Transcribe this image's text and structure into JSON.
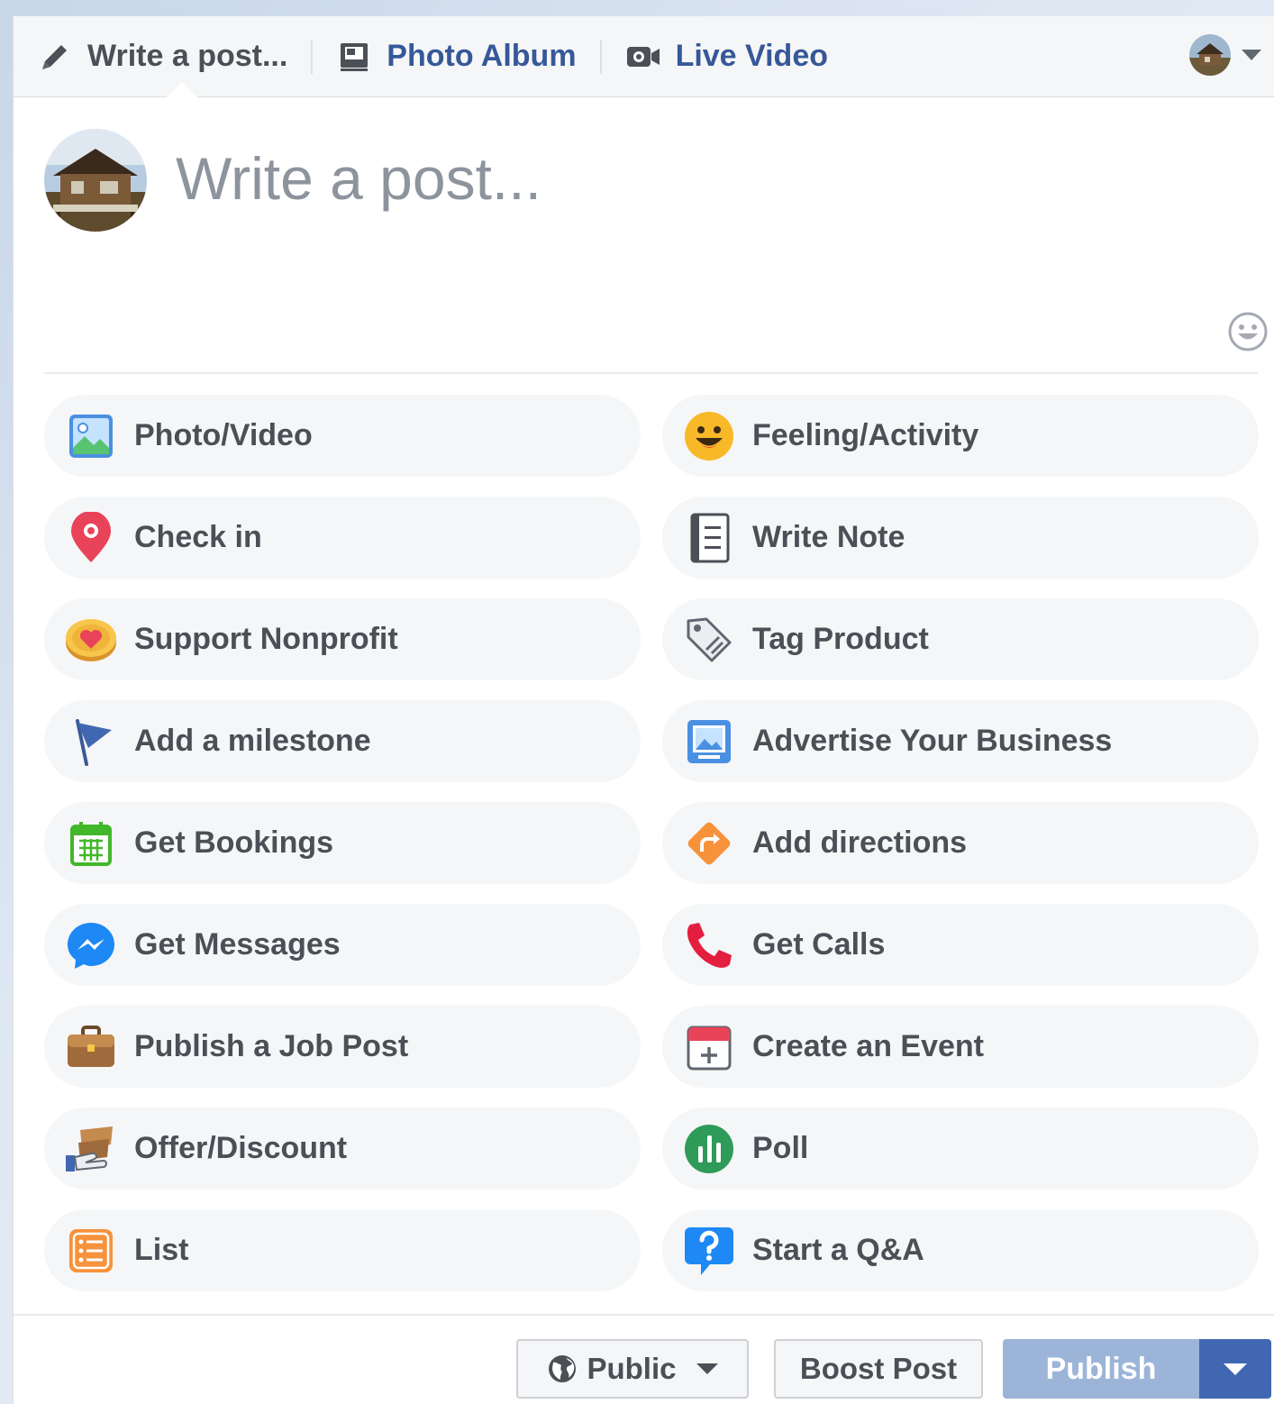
{
  "tabs": {
    "write_post": "Write a post...",
    "photo_album": "Photo Album",
    "live_video": "Live Video"
  },
  "composer": {
    "placeholder": "Write a post..."
  },
  "actions": [
    {
      "label": "Photo/Video",
      "icon": "photo-video-icon"
    },
    {
      "label": "Feeling/Activity",
      "icon": "feeling-smiley-icon"
    },
    {
      "label": "Check in",
      "icon": "location-pin-icon"
    },
    {
      "label": "Write Note",
      "icon": "notebook-icon"
    },
    {
      "label": "Support Nonprofit",
      "icon": "heart-coin-icon"
    },
    {
      "label": "Tag Product",
      "icon": "price-tag-icon"
    },
    {
      "label": "Add a milestone",
      "icon": "flag-icon"
    },
    {
      "label": "Advertise Your Business",
      "icon": "advertise-image-icon"
    },
    {
      "label": "Get Bookings",
      "icon": "calendar-icon"
    },
    {
      "label": "Add directions",
      "icon": "directions-icon"
    },
    {
      "label": "Get Messages",
      "icon": "messenger-icon"
    },
    {
      "label": "Get Calls",
      "icon": "phone-icon"
    },
    {
      "label": "Publish a Job Post",
      "icon": "briefcase-icon"
    },
    {
      "label": "Create an Event",
      "icon": "event-calendar-icon"
    },
    {
      "label": "Offer/Discount",
      "icon": "offer-tag-icon"
    },
    {
      "label": "Poll",
      "icon": "poll-chart-icon"
    },
    {
      "label": "List",
      "icon": "list-icon"
    },
    {
      "label": "Start a Q&A",
      "icon": "question-bubble-icon"
    }
  ],
  "footer": {
    "audience": "Public",
    "boost": "Boost Post",
    "publish": "Publish"
  },
  "colors": {
    "link": "#365899",
    "publish_disabled": "#9cb4d8",
    "publish_dropdown": "#4267b2"
  }
}
